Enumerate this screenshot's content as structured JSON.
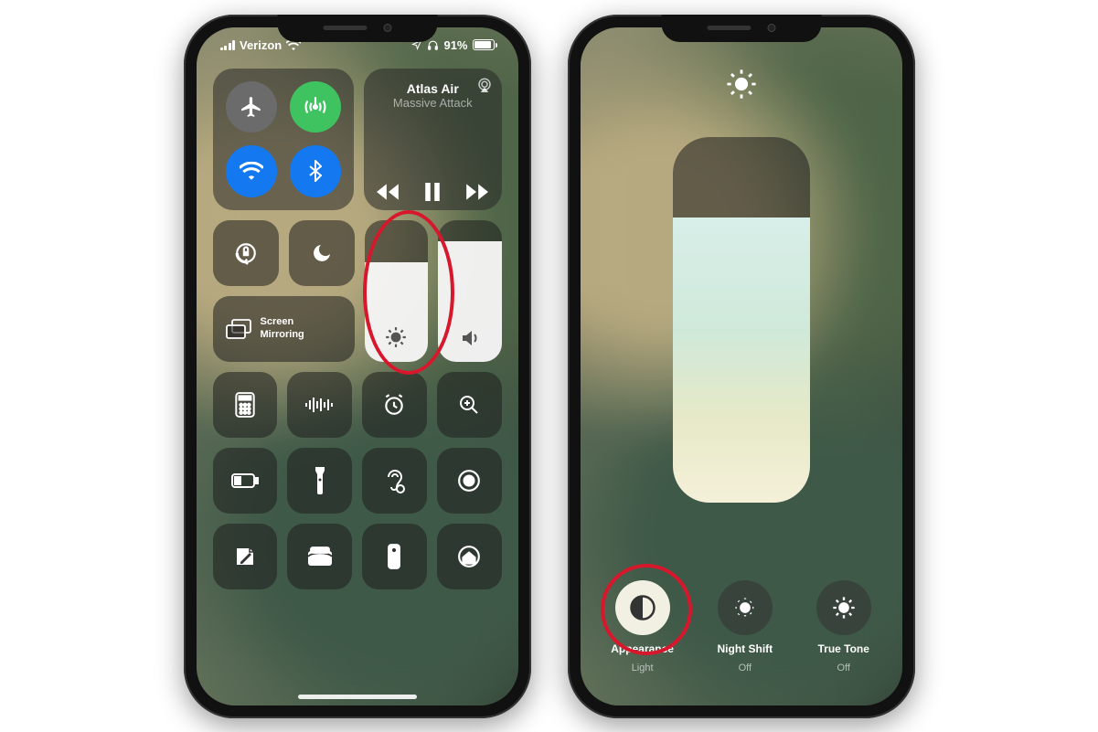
{
  "status": {
    "carrier": "Verizon",
    "battery": "91%"
  },
  "media": {
    "title": "Atlas Air",
    "artist": "Massive Attack"
  },
  "left": {
    "mirroring": "Screen\nMirroring",
    "brightness_pct": 70,
    "volume_pct": 85
  },
  "right": {
    "brightness_pct": 78,
    "options": [
      {
        "label": "Appearance",
        "sub": "Light"
      },
      {
        "label": "Night Shift",
        "sub": "Off"
      },
      {
        "label": "True Tone",
        "sub": "Off"
      }
    ]
  }
}
